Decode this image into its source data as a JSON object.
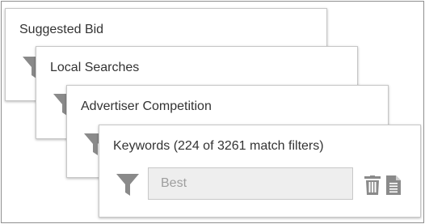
{
  "cards": [
    {
      "title": "Suggested Bid"
    },
    {
      "title": "Local Searches"
    },
    {
      "title": "Advertiser Competition"
    },
    {
      "title": "Keywords (224 of 3261 match filters)"
    }
  ],
  "search": {
    "placeholder": "Best",
    "value": ""
  },
  "icons": {
    "filter": "filter-funnel-icon",
    "delete": "trash-icon",
    "details": "document-icon"
  },
  "colors": {
    "icon_gray": "#8a8a8a",
    "input_bg": "#eeeeee",
    "border": "#c7c7c7",
    "frame_border": "#8f8f8f",
    "text": "#333333",
    "placeholder": "#9e9e9e"
  }
}
